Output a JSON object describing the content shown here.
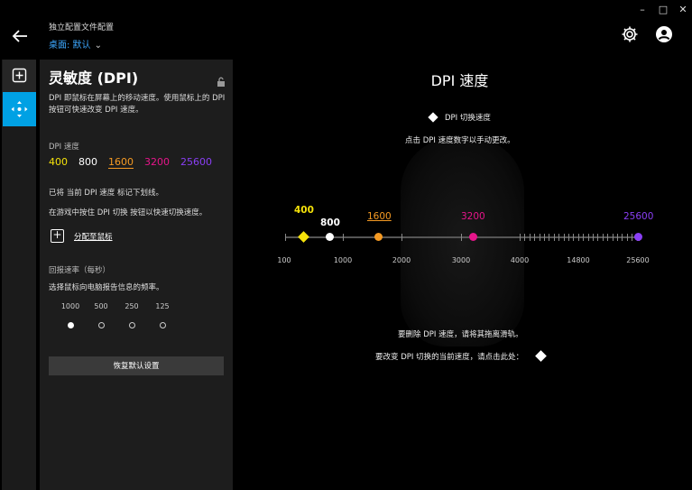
{
  "window": {
    "minimize": "–",
    "maximize": "□",
    "close": "✕"
  },
  "header": {
    "section": "独立配置文件配置",
    "profile": "桌面: 默认",
    "chevron": "⌄"
  },
  "panel": {
    "title": "灵敏度 (DPI)",
    "description": "DPI 即鼠标在屏幕上的移动速度。使用鼠标上的 DPI 按钮可快速改变 DPI 速度。",
    "dpi_label": "DPI 速度",
    "dpi_levels": [
      {
        "value": "400",
        "color": "#f5e20a"
      },
      {
        "value": "800",
        "color": "#ffffff"
      },
      {
        "value": "1600",
        "color": "#f59a23"
      },
      {
        "value": "3200",
        "color": "#e6158a"
      },
      {
        "value": "25600",
        "color": "#8a3ff5"
      }
    ],
    "marked_note": "已将 当前 DPI 速度 标记下划线。",
    "shift_note": "在游戏中按住 DPI 切换 按钮以快速切换速度。",
    "assign_label": "分配至鼠标",
    "report_rate_label": "回报速率（每秒）",
    "report_rate_desc": "选择鼠标向电脑报告信息的频率。",
    "report_rates": [
      "1000",
      "500",
      "250",
      "125"
    ],
    "report_rate_selected": "1000",
    "reset_label": "恢复默认设置"
  },
  "main": {
    "title": "DPI 速度",
    "shift_legend": "DPI 切换速度",
    "click_hint": "点击 DPI 速度数字以手动更改。",
    "remove_hint": "要删除 DPI 速度，请将其拖离滑轨。",
    "change_hint": "要改变 DPI 切换的当前速度，请点击此处：",
    "axis_labels": [
      "100",
      "1000",
      "2000",
      "3000",
      "4000",
      "14800",
      "25600"
    ],
    "markers": [
      {
        "label": "400",
        "color": "#f5e20a",
        "shape": "diamond"
      },
      {
        "label": "800",
        "color": "#ffffff",
        "shape": "circle"
      },
      {
        "label": "1600",
        "color": "#f59a23",
        "shape": "circle"
      },
      {
        "label": "3200",
        "color": "#e6158a",
        "shape": "circle"
      },
      {
        "label": "25600",
        "color": "#8a3ff5",
        "shape": "circle"
      }
    ]
  }
}
